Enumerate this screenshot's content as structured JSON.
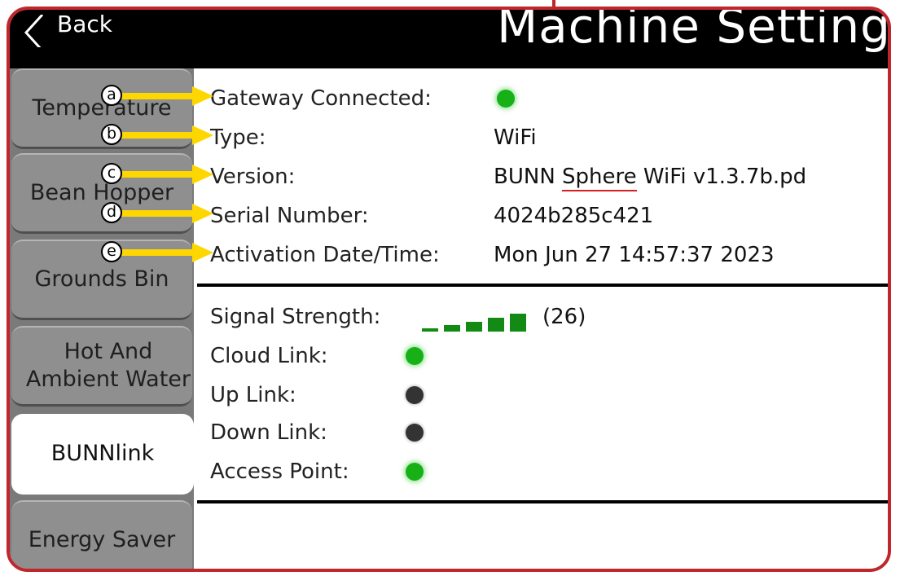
{
  "header": {
    "back_label": "Back",
    "title": "Machine Setting"
  },
  "sidebar": {
    "items": [
      {
        "label": "Temperature"
      },
      {
        "label": "Bean Hopper"
      },
      {
        "label": "Grounds Bin"
      },
      {
        "label": "Hot And\nAmbient Water"
      },
      {
        "label": "BUNNlink",
        "active": true
      },
      {
        "label": "Energy Saver"
      }
    ]
  },
  "gateway": {
    "connected_label": "Gateway Connected:",
    "connected_status": "on",
    "type_label": "Type:",
    "type_value": "WiFi",
    "version_label": "Version:",
    "version_prefix": "BUNN ",
    "version_highlight": "Sphere",
    "version_suffix": " WiFi v1.3.7b.pd",
    "serial_label": "Serial Number:",
    "serial_value": "4024b285c421",
    "activation_label": "Activation Date/Time:",
    "activation_value": "Mon Jun 27 14:57:37 2023"
  },
  "links": {
    "signal_label": "Signal Strength:",
    "signal_bars_lit": 5,
    "signal_value": "(26)",
    "cloud_label": "Cloud Link:",
    "cloud_status": "on",
    "up_label": "Up Link:",
    "up_status": "off",
    "down_label": "Down Link:",
    "down_status": "off",
    "access_label": "Access Point:",
    "access_status": "on"
  },
  "callouts": [
    "a",
    "b",
    "c",
    "d",
    "e"
  ],
  "colors": {
    "frame": "#c0272d",
    "status_on": "#17b117",
    "status_off": "#333333",
    "signal": "#138a13",
    "callout_arrow": "#ffd700",
    "version_underline": "#d42020"
  }
}
